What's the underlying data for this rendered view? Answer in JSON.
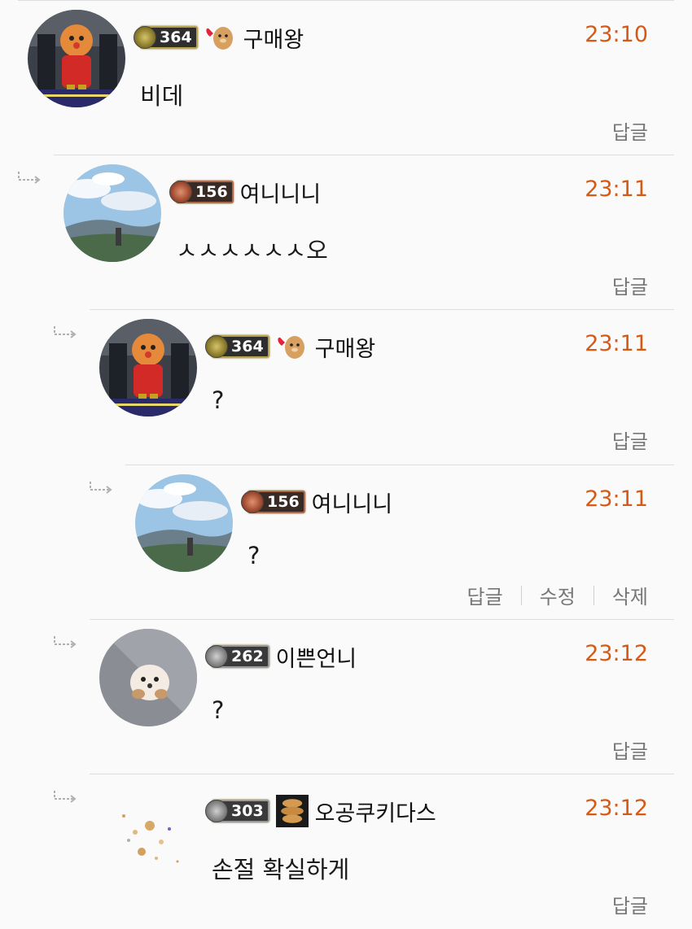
{
  "comments": [
    {
      "level": "364",
      "username": "구매왕",
      "time": "23:10",
      "text": "비데",
      "actions": [
        "답글"
      ]
    },
    {
      "level": "156",
      "username": "여니니니",
      "time": "23:11",
      "text": "ㅅㅅㅅㅅㅅㅅ오",
      "actions": [
        "답글"
      ]
    },
    {
      "level": "364",
      "username": "구매왕",
      "time": "23:11",
      "text": "?",
      "actions": [
        "답글"
      ]
    },
    {
      "level": "156",
      "username": "여니니니",
      "time": "23:11",
      "text": "?",
      "actions": [
        "답글",
        "수정",
        "삭제"
      ]
    },
    {
      "level": "262",
      "username": "이쁜언니",
      "time": "23:12",
      "text": "?",
      "actions": [
        "답글"
      ]
    },
    {
      "level": "303",
      "username": "오공쿠키다스",
      "time": "23:12",
      "text": "손절 확실하게",
      "actions": [
        "답글"
      ]
    }
  ],
  "colors": {
    "time": "#d45a16",
    "action": "#777777",
    "divider": "#dedede"
  },
  "icons": [
    "reply-arrow-icon",
    "level-badge-icon",
    "emblem-icon"
  ]
}
